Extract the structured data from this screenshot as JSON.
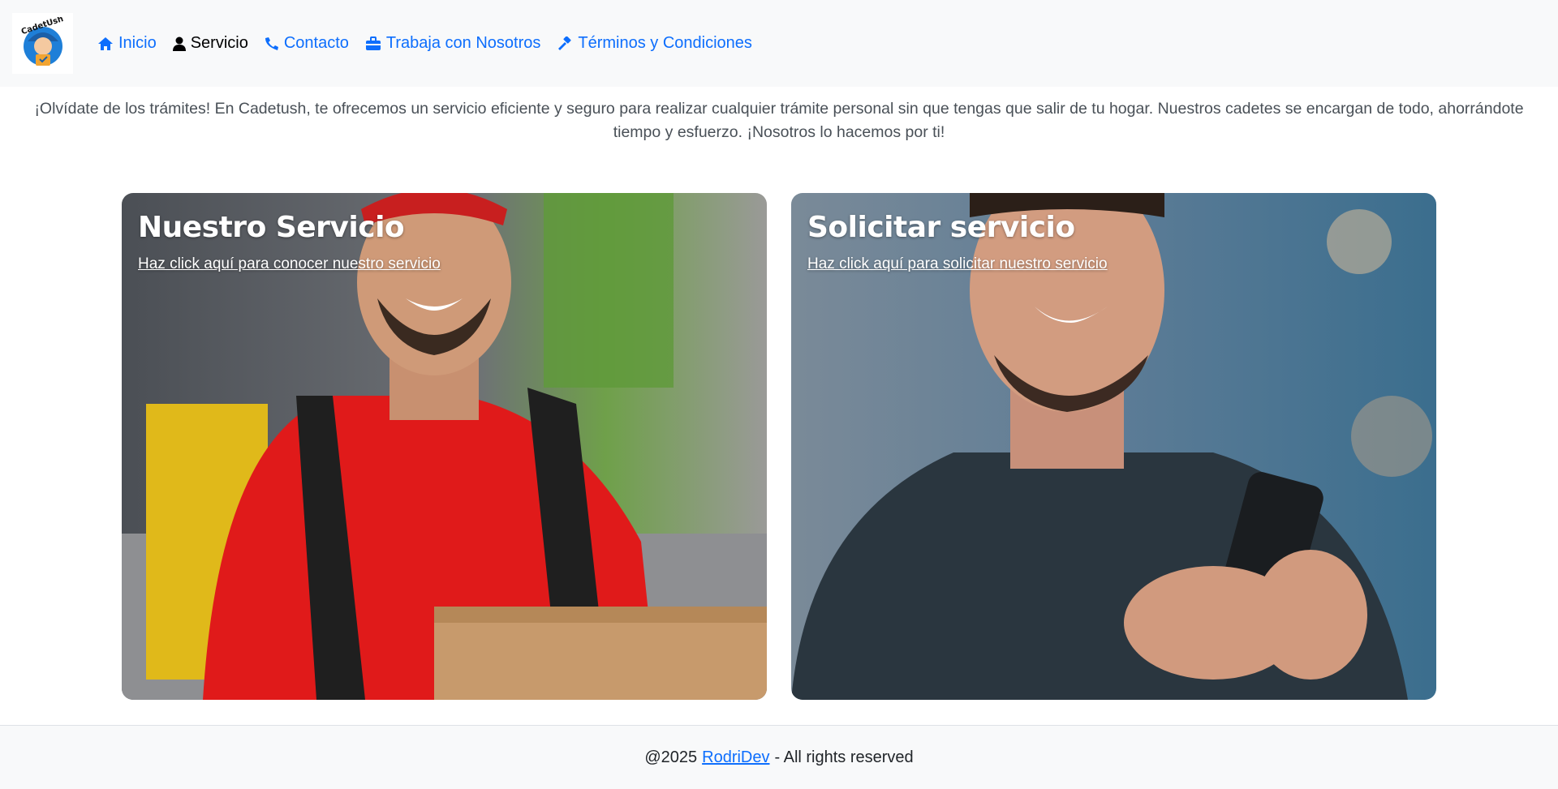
{
  "brand": {
    "logo_text": "CadetUsh"
  },
  "nav": {
    "items": [
      {
        "label": "Inicio",
        "icon": "home-icon"
      },
      {
        "label": "Servicio",
        "icon": "user-icon"
      },
      {
        "label": "Contacto",
        "icon": "phone-icon"
      },
      {
        "label": "Trabaja con Nosotros",
        "icon": "toolbox-icon"
      },
      {
        "label": "Términos y Condiciones",
        "icon": "gavel-icon"
      }
    ],
    "active": "Servicio"
  },
  "intro": {
    "text": "¡Olvídate de los trámites! En Cadetush, te ofrecemos un servicio eficiente y seguro para realizar cualquier trámite personal sin que tengas que salir de tu hogar. Nuestros cadetes se encargan de todo, ahorrándote tiempo y esfuerzo. ¡Nosotros lo hacemos por ti!"
  },
  "cards": [
    {
      "title": "Nuestro Servicio",
      "link": "Haz click aquí para conocer nuestro servicio",
      "image": "delivery-man-photo"
    },
    {
      "title": "Solicitar servicio",
      "link": "Haz click aquí para solicitar nuestro servicio",
      "image": "man-with-phone-photo"
    }
  ],
  "footer": {
    "prefix": "@2025",
    "author": "RodriDev",
    "suffix": "- All rights reserved"
  },
  "colors": {
    "link": "#0d6efd",
    "navbar_bg": "#f8f9fa",
    "text_muted": "#495057"
  }
}
